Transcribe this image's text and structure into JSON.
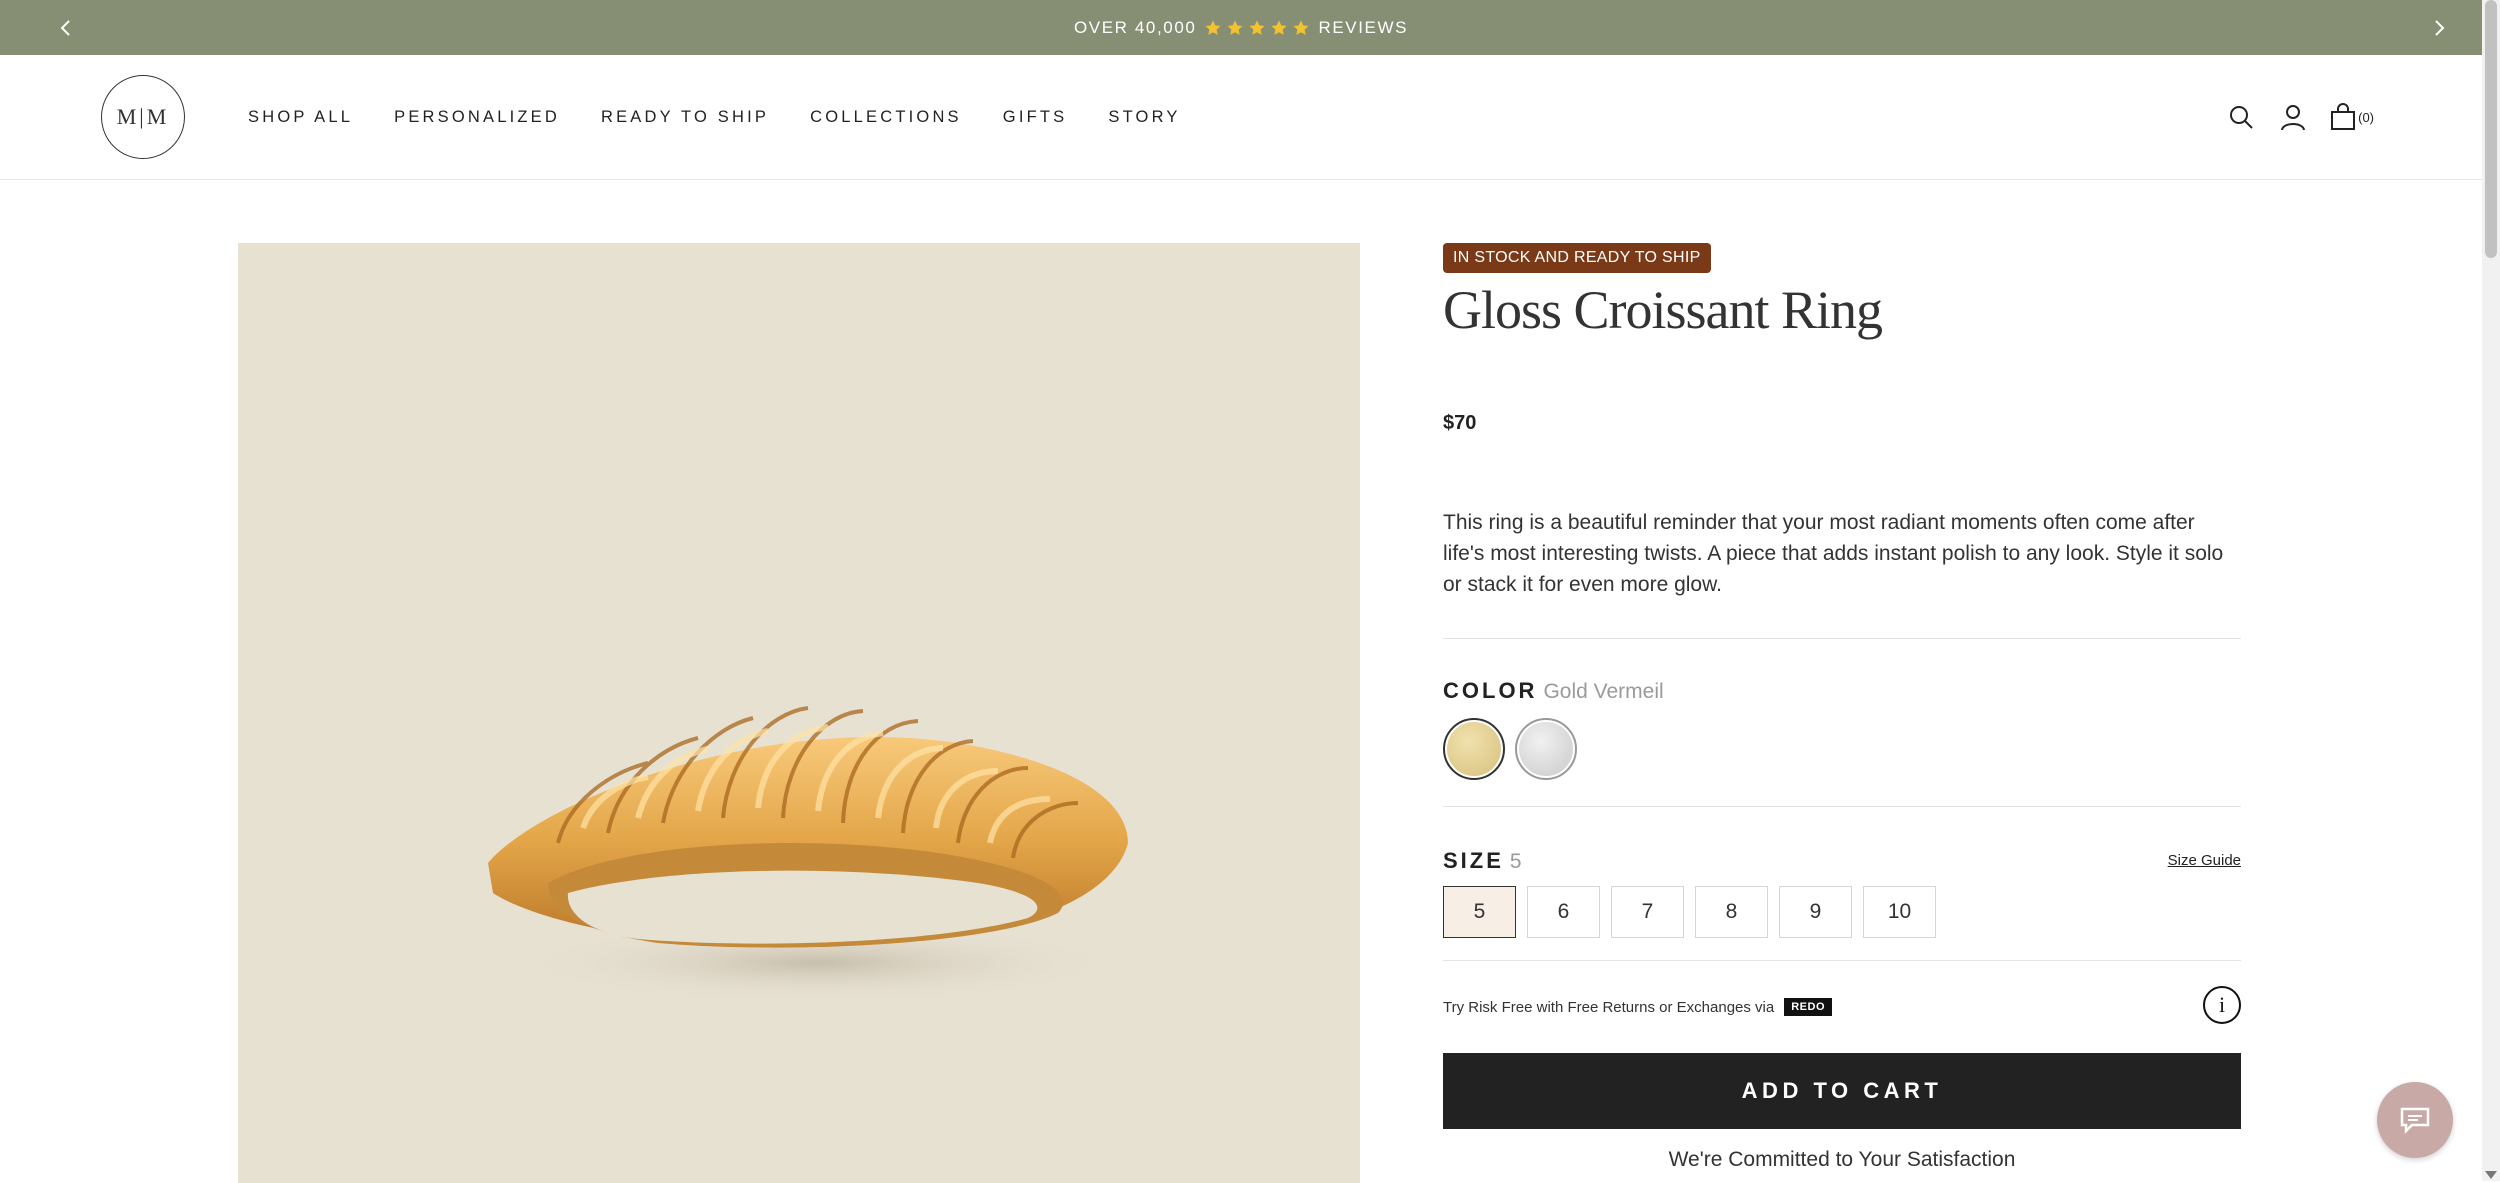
{
  "announcement": {
    "prefix": "OVER 40,000",
    "suffix": "REVIEWS",
    "star_count": 5,
    "star_color": "#f2c230",
    "prev_icon": "chevron-left-icon",
    "next_icon": "chevron-right-icon"
  },
  "header": {
    "logo_text": "M|M",
    "nav": [
      "SHOP ALL",
      "PERSONALIZED",
      "READY TO SHIP",
      "COLLECTIONS",
      "GIFTS",
      "STORY"
    ],
    "cart_count": "(0)",
    "icons": [
      "search-icon",
      "account-icon",
      "bag-icon"
    ]
  },
  "product": {
    "badge": "IN STOCK AND READY TO SHIP",
    "title": "Gloss Croissant Ring",
    "price": "$70",
    "description": "This ring is a beautiful reminder that your most radiant moments often come after life's most interesting twists. A piece that adds instant polish to any look. Style it solo or stack it for even more glow.",
    "color_label": "COLOR",
    "color_value": "Gold Vermeil",
    "colors": [
      {
        "name": "Gold Vermeil",
        "hex": "#e3cf92",
        "selected": true
      },
      {
        "name": "Sterling Silver",
        "hex": "#d9d9d9",
        "selected": false
      }
    ],
    "size_label": "SIZE",
    "size_value": "5",
    "size_guide": "Size Guide",
    "sizes": [
      "5",
      "6",
      "7",
      "8",
      "9",
      "10"
    ],
    "selected_size": "5",
    "returns_text": "Try Risk Free with Free Returns or Exchanges via",
    "redo_label": "REDO",
    "add_to_cart": "ADD TO CART",
    "committed": "We're Committed to Your Satisfaction",
    "image_bg": "#e7e1d2"
  },
  "chat": {
    "icon": "chat-icon",
    "color": "#c9a9a6"
  }
}
